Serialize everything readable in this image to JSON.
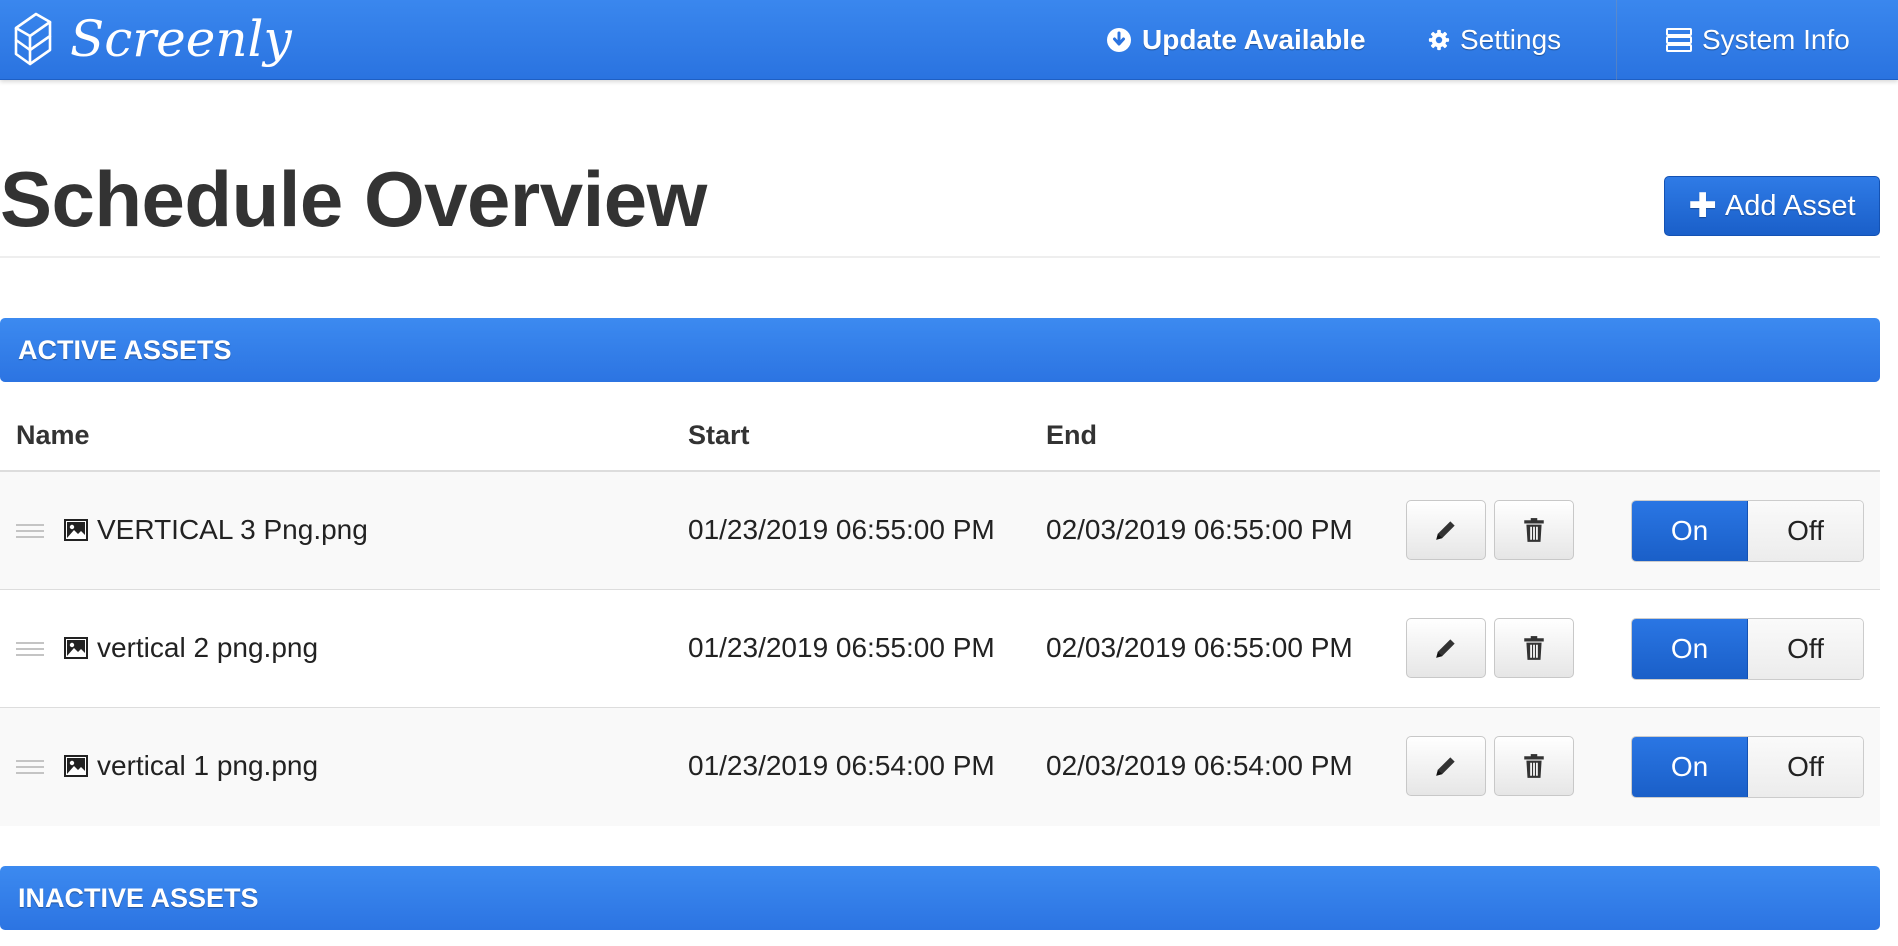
{
  "navbar": {
    "brand": "Screenly",
    "update_label": "Update Available",
    "settings_label": "Settings",
    "sysinfo_label": "System Info"
  },
  "page": {
    "title": "Schedule Overview",
    "add_asset_label": "Add Asset"
  },
  "active_section": {
    "title": "ACTIVE ASSETS",
    "columns": {
      "name": "Name",
      "start": "Start",
      "end": "End"
    },
    "rows": [
      {
        "name": "VERTICAL 3 Png.png",
        "start": "01/23/2019 06:55:00 PM",
        "end": "02/03/2019 06:55:00 PM",
        "on_label": "On",
        "off_label": "Off"
      },
      {
        "name": "vertical 2 png.png",
        "start": "01/23/2019 06:55:00 PM",
        "end": "02/03/2019 06:55:00 PM",
        "on_label": "On",
        "off_label": "Off"
      },
      {
        "name": "vertical 1 png.png",
        "start": "01/23/2019 06:54:00 PM",
        "end": "02/03/2019 06:54:00 PM",
        "on_label": "On",
        "off_label": "Off"
      }
    ]
  },
  "inactive_section": {
    "title": "INACTIVE ASSETS"
  },
  "icons": {
    "brand": "screenly-logo-icon",
    "update": "download-circle-icon",
    "settings": "gear-icon",
    "sysinfo": "server-stack-icon",
    "add": "plus-icon",
    "drag": "drag-handle-icon",
    "asset": "image-icon",
    "edit": "pencil-icon",
    "delete": "trash-icon"
  },
  "colors": {
    "primary": "#2a73e0",
    "primary_dark": "#1a5fc9",
    "text": "#333333"
  }
}
